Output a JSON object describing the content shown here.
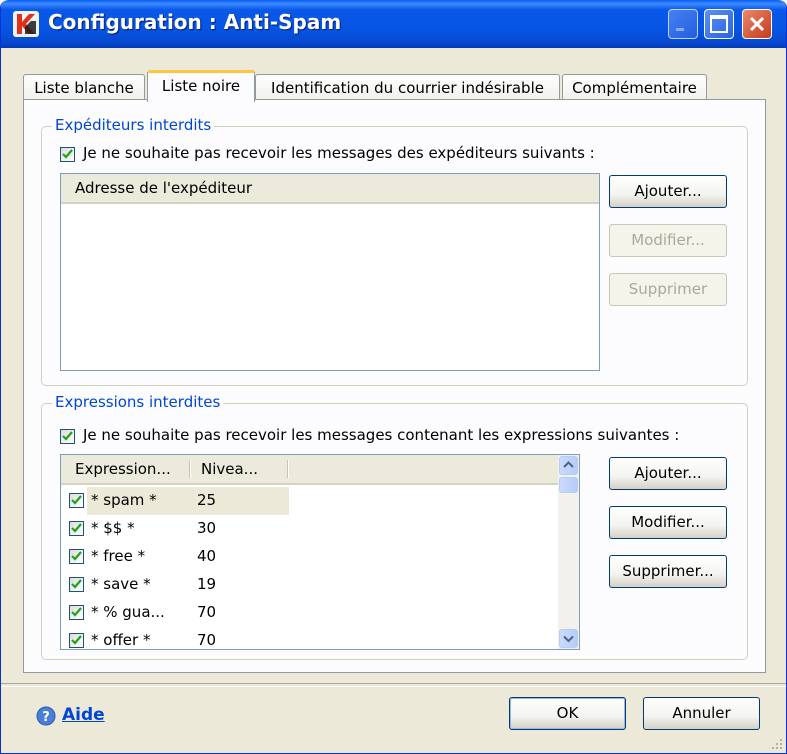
{
  "window": {
    "title": "Configuration : Anti-Spam",
    "colors": {
      "titlebar": "#0655e3",
      "face": "#ece9d8",
      "accent": "#0046d5",
      "tab_highlight": "#ffc83c"
    }
  },
  "tabs": [
    {
      "label": "Liste blanche",
      "active": false
    },
    {
      "label": "Liste noire",
      "active": true
    },
    {
      "label": "Identification du courrier indésirable",
      "active": false
    },
    {
      "label": "Complémentaire",
      "active": false
    }
  ],
  "senders": {
    "group_title": "Expéditeurs interdits",
    "checkbox_label": "Je ne souhaite pas recevoir les messages des expéditeurs suivants :",
    "checked": true,
    "column_header": "Adresse de l'expéditeur",
    "buttons": {
      "add": "Ajouter...",
      "edit": "Modifier...",
      "delete": "Supprimer"
    }
  },
  "expressions": {
    "group_title": "Expressions interdites",
    "checkbox_label": "Je ne souhaite pas recevoir les messages contenant les expressions suivantes :",
    "checked": true,
    "columns": [
      "Expression...",
      "Nivea..."
    ],
    "rows": [
      {
        "expression": "* spam *",
        "level": "25",
        "checked": true,
        "selected": true
      },
      {
        "expression": "* $$ *",
        "level": "30",
        "checked": true
      },
      {
        "expression": "* free *",
        "level": "40",
        "checked": true
      },
      {
        "expression": "* save *",
        "level": "19",
        "checked": true
      },
      {
        "expression": "* % gua...",
        "level": "70",
        "checked": true
      },
      {
        "expression": "* offer *",
        "level": "70",
        "checked": true
      }
    ],
    "buttons": {
      "add": "Ajouter...",
      "edit": "Modifier...",
      "delete": "Supprimer..."
    }
  },
  "footer": {
    "help": "Aide",
    "ok": "OK",
    "cancel": "Annuler"
  }
}
